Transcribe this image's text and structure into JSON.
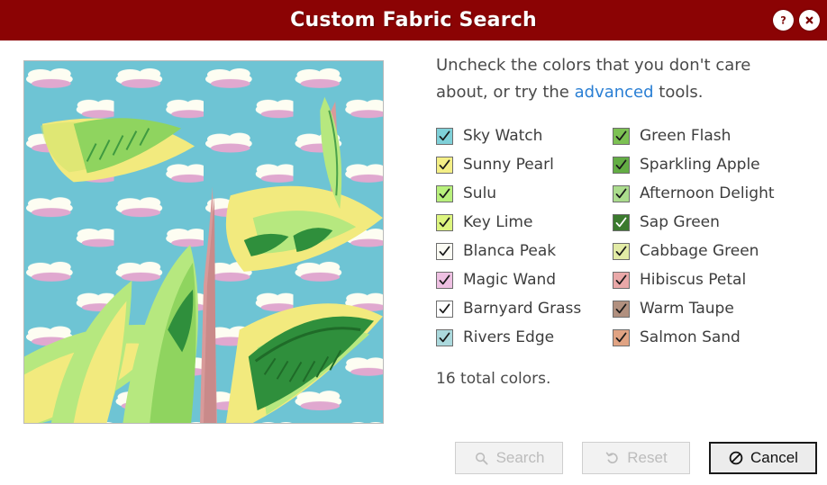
{
  "window": {
    "title": "Custom Fabric Search",
    "titlebar_bg": "#8b0304",
    "help_icon": "question-mark-circle-icon",
    "close_icon": "close-circle-icon"
  },
  "preview": {
    "alt": "tropical banana leaf fabric swatch with clouds",
    "sky_color": "#6ec4d4",
    "cloud_color": "#fdfdf2",
    "cloud_shadow": "#e0a8cf",
    "leaf_yellow": "#f2ea7e",
    "leaf_light_green": "#b6e87f",
    "leaf_mid_green": "#8fd45f",
    "leaf_dark_green": "#2f8f3c",
    "stem_pink": "#d89a9a"
  },
  "instructions": {
    "text_before": "Uncheck the colors that you don't care about, or try the ",
    "link_label": "advanced",
    "text_after": " tools.",
    "link_color": "#2a7fd4"
  },
  "colors": {
    "left_column": [
      {
        "label": "Sky Watch",
        "swatch": "#7fd0d8",
        "checked": true,
        "check_color": "#1a1a1a"
      },
      {
        "label": "Sunny Pearl",
        "swatch": "#f4ef86",
        "checked": true,
        "check_color": "#1a1a1a"
      },
      {
        "label": "Sulu",
        "swatch": "#b8f07c",
        "checked": true,
        "check_color": "#1a1a1a"
      },
      {
        "label": "Key Lime",
        "swatch": "#ddf57f",
        "checked": true,
        "check_color": "#1a1a1a"
      },
      {
        "label": "Blanca Peak",
        "swatch": "#fbfbf4",
        "checked": true,
        "check_color": "#1a1a1a"
      },
      {
        "label": "Magic Wand",
        "swatch": "#eec0e2",
        "checked": true,
        "check_color": "#1a1a1a"
      },
      {
        "label": "Barnyard Grass",
        "swatch": "#47a council",
        "checked": true,
        "check_color": "#1a1a1a"
      },
      {
        "label": "Rivers Edge",
        "swatch": "#abd9dd",
        "checked": true,
        "check_color": "#1a1a1a"
      }
    ],
    "right_column": [
      {
        "label": "Green Flash",
        "swatch": "#7cc153",
        "checked": true,
        "check_color": "#1a1a1a"
      },
      {
        "label": "Sparkling Apple",
        "swatch": "#63ad44",
        "checked": true,
        "check_color": "#1a1a1a"
      },
      {
        "label": "Afternoon Delight",
        "swatch": "#abdc8d",
        "checked": true,
        "check_color": "#1a1a1a"
      },
      {
        "label": "Sap Green",
        "swatch": "#3b7a2e",
        "checked": true,
        "check_color": "#ffffff"
      },
      {
        "label": "Cabbage Green",
        "swatch": "#e2eba6",
        "checked": true,
        "check_color": "#1a1a1a"
      },
      {
        "label": "Hibiscus Petal",
        "swatch": "#e9a8a8",
        "checked": true,
        "check_color": "#1a1a1a"
      },
      {
        "label": "Warm Taupe",
        "swatch": "#b1907f",
        "checked": true,
        "check_color": "#1a1a1a"
      },
      {
        "label": "Salmon Sand",
        "swatch": "#e0a383",
        "checked": true,
        "check_color": "#1a1a1a"
      }
    ],
    "total_text": "16 total colors."
  },
  "footer": {
    "search": {
      "label": "Search",
      "icon": "magnifier-icon",
      "enabled": false
    },
    "reset": {
      "label": "Reset",
      "icon": "undo-arrow-icon",
      "enabled": false
    },
    "cancel": {
      "label": "Cancel",
      "icon": "prohibition-icon",
      "enabled": true
    }
  }
}
